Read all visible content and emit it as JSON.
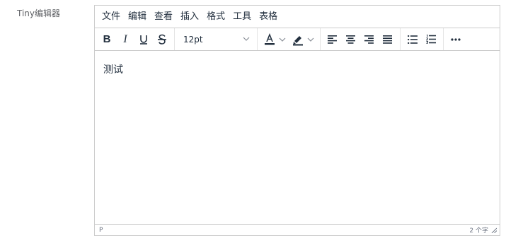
{
  "field": {
    "label": "Tiny编辑器"
  },
  "menubar": {
    "items": [
      "文件",
      "编辑",
      "查看",
      "插入",
      "格式",
      "工具",
      "表格"
    ]
  },
  "toolbar": {
    "bold_label": "B",
    "italic_label": "I",
    "underline_label": "U",
    "strike_label": "S",
    "font_size_value": "12pt",
    "text_color": "#222f3e",
    "highlight_color": "#222f3e"
  },
  "content": {
    "text": "测试"
  },
  "statusbar": {
    "path": "P",
    "word_count": "2 个字"
  }
}
